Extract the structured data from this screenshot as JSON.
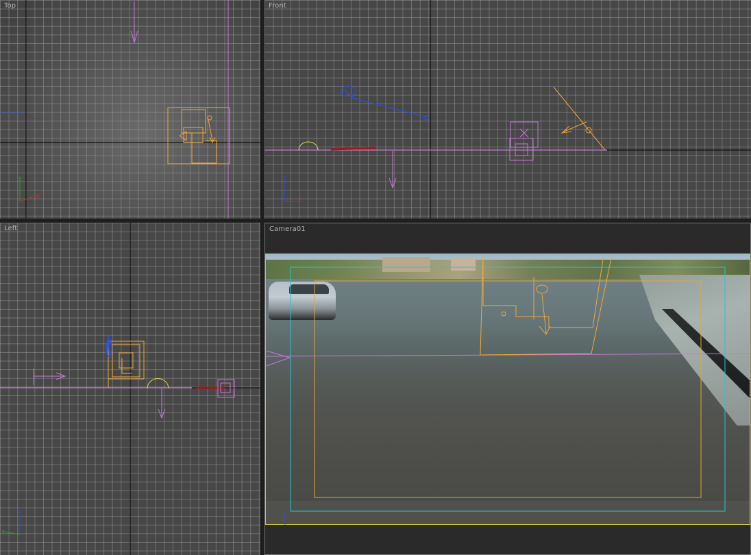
{
  "viewports": {
    "top": {
      "label": "Top"
    },
    "front": {
      "label": "Front"
    },
    "left": {
      "label": "Left"
    },
    "camera": {
      "label": "Camera01"
    }
  },
  "axis_tripod": {
    "top": [
      "x",
      "y"
    ],
    "front": [
      "x",
      "z"
    ],
    "left": [
      "y",
      "z"
    ],
    "camera": [
      "z"
    ]
  },
  "colors": {
    "grid_bg": "#4b4b4b",
    "grid_line": "#969696",
    "world_axis": "#000000",
    "helper_line": "#c679d6",
    "object_wire": "#f0a83a",
    "light_wire": "#2e4fd6",
    "target_wire": "#a31616",
    "safe_frame_outer": "#21c8d4",
    "safe_frame_inner": "#e0a63a",
    "render_frame": "#c9c23a"
  },
  "icons": {
    "camera_arrow": "arrow-down-icon",
    "light": "spotlight-icon",
    "sun": "sun-helper-icon",
    "tripod": "axis-tripod-icon"
  }
}
